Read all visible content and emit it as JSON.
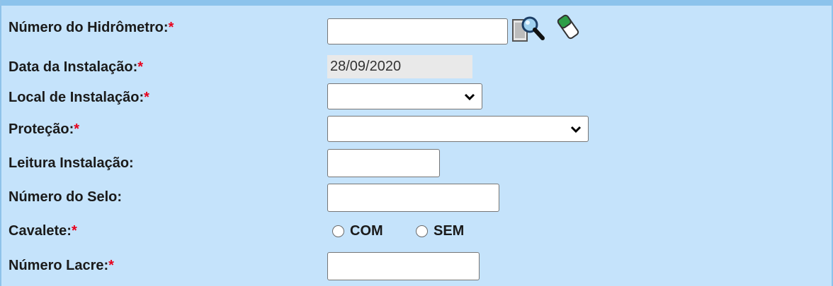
{
  "form": {
    "hidrometro": {
      "label": "Número do Hidrômetro:",
      "required": "*",
      "value": ""
    },
    "data_instalacao": {
      "label": "Data da Instalação:",
      "required": "*",
      "value": "28/09/2020"
    },
    "local_instalacao": {
      "label": "Local de Instalação:",
      "required": "*",
      "value": ""
    },
    "protecao": {
      "label": "Proteção:",
      "required": "*",
      "value": ""
    },
    "leitura": {
      "label": "Leitura Instalação:",
      "value": ""
    },
    "selo": {
      "label": "Número do Selo:",
      "value": ""
    },
    "cavalete": {
      "label": "Cavalete:",
      "required": "*",
      "options": [
        {
          "label": "COM",
          "checked": false
        },
        {
          "label": "SEM",
          "checked": false
        }
      ]
    },
    "lacre": {
      "label": "Número Lacre:",
      "required": "*",
      "value": ""
    }
  },
  "icons": {
    "search": "magnifier-document-icon",
    "clear": "eraser-icon"
  },
  "colors": {
    "background": "#c5e3fb",
    "required": "#e8001c",
    "header": "#8cc3ec"
  }
}
